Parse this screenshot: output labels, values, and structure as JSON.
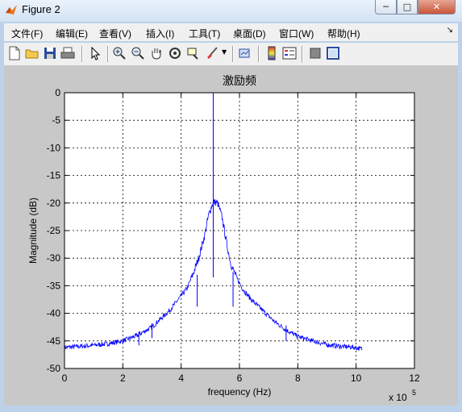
{
  "window": {
    "title": "Figure 2"
  },
  "menu": {
    "items": [
      "文件(F)",
      "编辑(E)",
      "查看(V)",
      "插入(I)",
      "工具(T)",
      "桌面(D)",
      "窗口(W)",
      "帮助(H)"
    ]
  },
  "toolbar": {
    "icons": [
      "new-figure-icon",
      "open-file-icon",
      "save-icon",
      "print-icon",
      "edit-plot-arrow-icon",
      "zoom-in-icon",
      "zoom-out-icon",
      "pan-hand-icon",
      "rotate-3d-icon",
      "data-cursor-icon",
      "brush-icon",
      "brush-dropdown-icon",
      "link-plot-icon",
      "insert-colorbar-icon",
      "insert-legend-icon",
      "hide-plot-tools-icon",
      "show-plot-tools-icon"
    ]
  },
  "chart_data": {
    "type": "line",
    "title": "激励频",
    "xlabel": "frequency (Hz)",
    "ylabel": "Magnitude (dB)",
    "x_exponent_label": "x 10",
    "x_exponent_power": "5",
    "xlim": [
      0,
      12
    ],
    "ylim": [
      -50,
      0
    ],
    "xticks": [
      "0",
      "2",
      "4",
      "6",
      "8",
      "10",
      "12"
    ],
    "yticks": [
      "0",
      "-5",
      "-10",
      "-15",
      "-20",
      "-25",
      "-30",
      "-35",
      "-40",
      "-45",
      "-50"
    ],
    "grid": true,
    "line_color": "#0000ff",
    "series": [
      {
        "x": [
          0,
          0.5,
          1.0,
          1.5,
          2.0,
          2.5,
          3.0,
          3.3,
          3.6,
          3.9,
          4.2,
          4.4,
          4.6,
          4.8,
          4.95,
          5.1,
          5.25,
          5.4,
          5.55,
          5.7,
          5.9,
          6.1,
          6.4,
          6.8,
          7.2,
          7.6,
          8.0,
          8.5,
          9.0,
          9.5,
          10.0,
          10.2
        ],
        "y": [
          -46.2,
          -46.0,
          -45.8,
          -45.5,
          -45.0,
          -44.0,
          -42.5,
          -41.0,
          -39.5,
          -37.5,
          -35.5,
          -33.0,
          -30.0,
          -26.0,
          -22.0,
          -19.8,
          -20.0,
          -22.5,
          -27.0,
          -31.0,
          -33.5,
          -35.5,
          -37.5,
          -39.5,
          -41.5,
          -43.0,
          -44.2,
          -45.0,
          -45.7,
          -46.0,
          -46.2,
          -46.5
        ]
      }
    ],
    "spikes": [
      {
        "x": 5.1,
        "y_top": 0,
        "y_bottom": -33.5
      },
      {
        "x": 4.55,
        "y_top": -33.0,
        "y_bottom": -38.8
      },
      {
        "x": 5.78,
        "y_top": -32.5,
        "y_bottom": -38.8
      },
      {
        "x": 2.55,
        "y_top": -43.3,
        "y_bottom": -45.8
      },
      {
        "x": 3.0,
        "y_top": -41.8,
        "y_bottom": -44.5
      },
      {
        "x": 7.6,
        "y_top": -42.2,
        "y_bottom": -45.0
      }
    ]
  }
}
